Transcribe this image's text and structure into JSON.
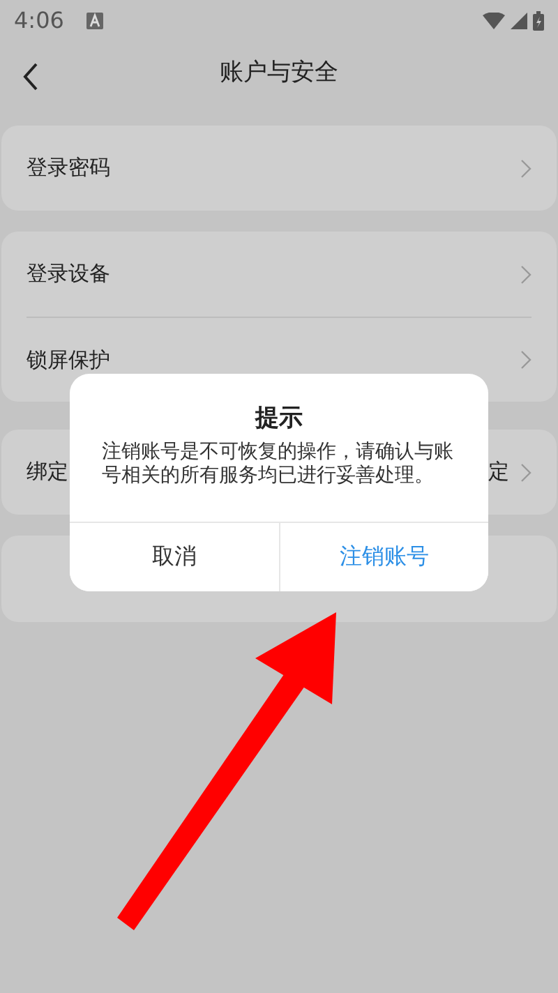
{
  "status_bar": {
    "time": "4:06"
  },
  "header": {
    "title": "账户与安全"
  },
  "groups": [
    {
      "items": [
        {
          "label": "登录密码"
        }
      ]
    },
    {
      "items": [
        {
          "label": "登录设备"
        },
        {
          "label": "锁屏保护"
        }
      ]
    },
    {
      "items": [
        {
          "label": "绑定",
          "value": "定"
        }
      ]
    }
  ],
  "dialog": {
    "title": "提示",
    "message": "注销账号是不可恢复的操作，请确认与账号相关的所有服务均已进行妥善处理。",
    "buttons": [
      {
        "label": "取消",
        "kind": "cancel"
      },
      {
        "label": "注销账号",
        "kind": "confirm"
      }
    ]
  }
}
